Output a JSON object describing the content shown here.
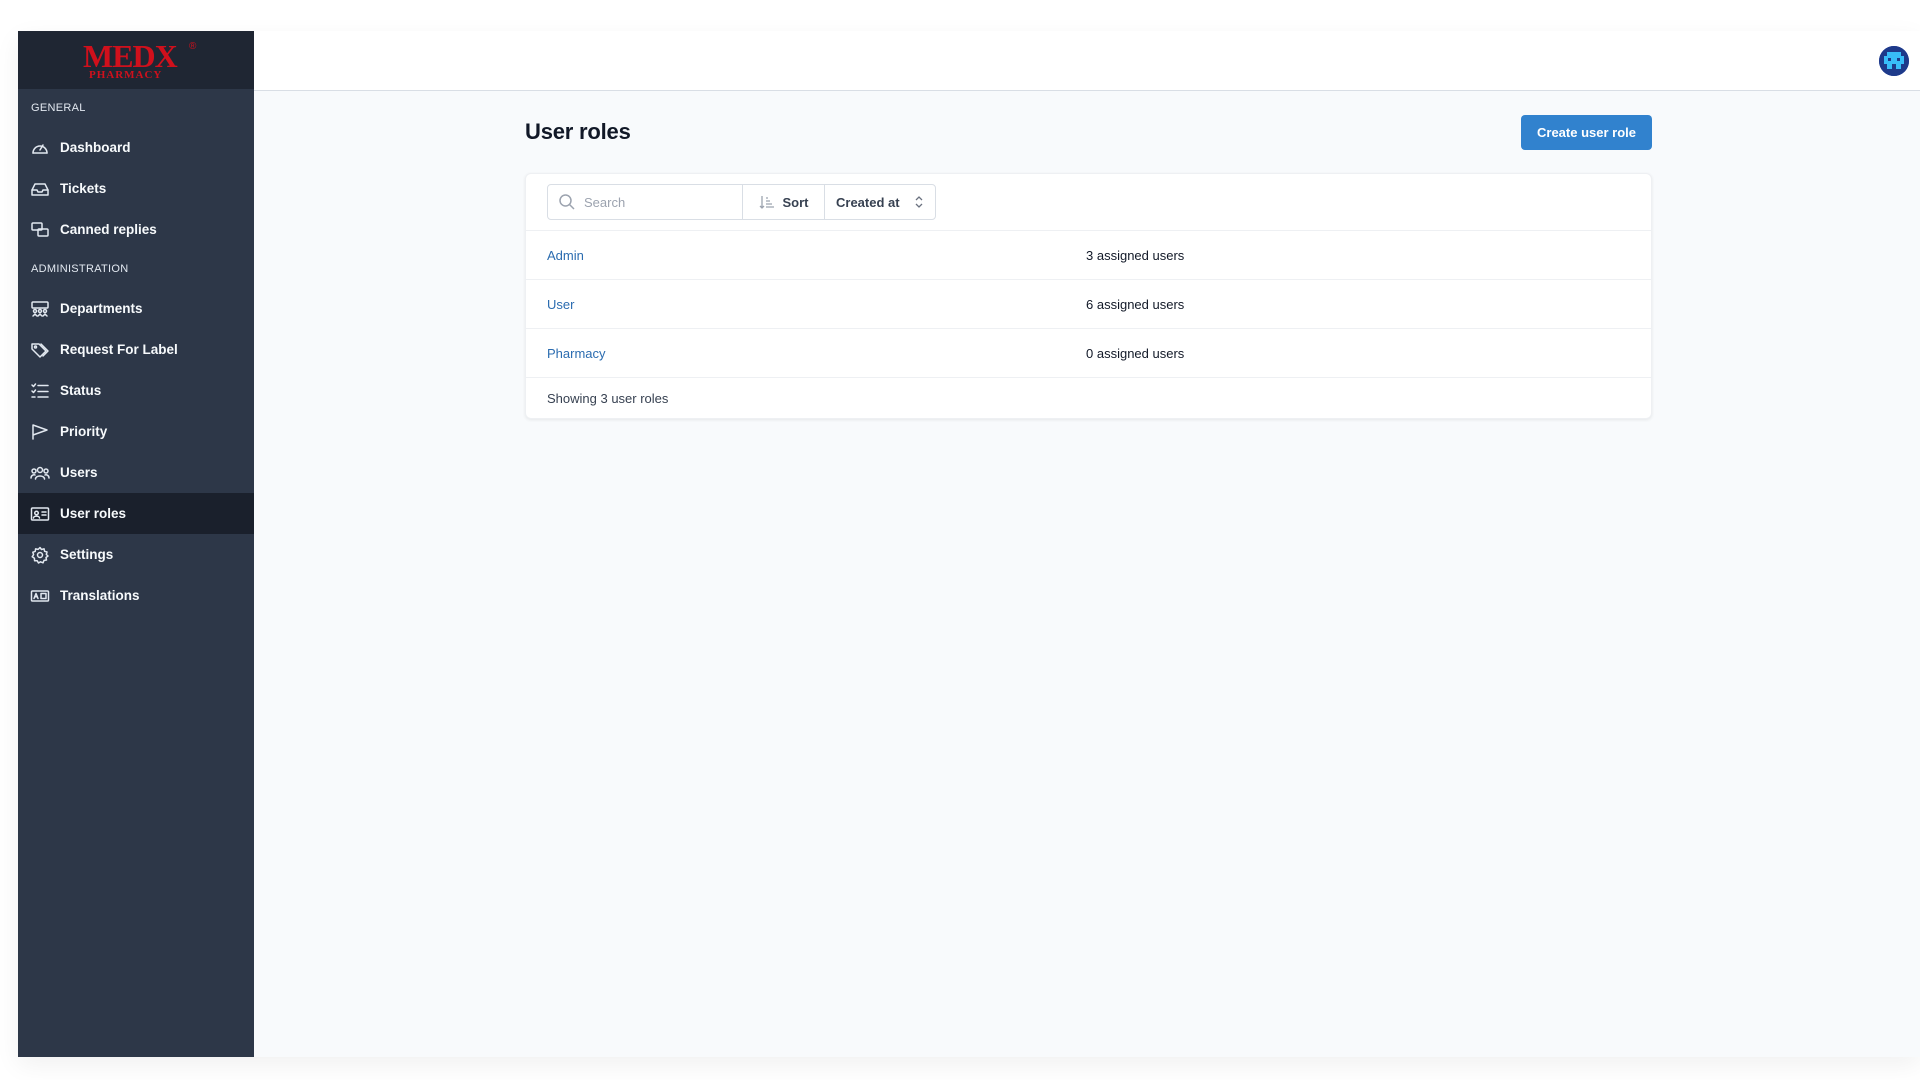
{
  "brand": {
    "logo_text": "MEDX",
    "logo_sub": "PHARMACY",
    "logo_mark": "®",
    "color": "#d0101c"
  },
  "sidebar": {
    "sections": [
      {
        "title": "GENERAL",
        "items": [
          {
            "label": "Dashboard",
            "icon": "dashboard-gauge-icon"
          },
          {
            "label": "Tickets",
            "icon": "inbox-tray-icon"
          },
          {
            "label": "Canned replies",
            "icon": "chat-bubbles-icon"
          }
        ]
      },
      {
        "title": "ADMINISTRATION",
        "items": [
          {
            "label": "Departments",
            "icon": "departments-icon"
          },
          {
            "label": "Request For Label",
            "icon": "tags-icon"
          },
          {
            "label": "Status",
            "icon": "checklist-icon"
          },
          {
            "label": "Priority",
            "icon": "flag-icon"
          },
          {
            "label": "Users",
            "icon": "users-group-icon"
          },
          {
            "label": "User roles",
            "icon": "id-card-icon",
            "active": true
          },
          {
            "label": "Settings",
            "icon": "gear-icon"
          },
          {
            "label": "Translations",
            "icon": "language-icon"
          }
        ]
      }
    ]
  },
  "header": {
    "title": "User roles",
    "create_button": "Create user role"
  },
  "toolbar": {
    "search_placeholder": "Search",
    "sort_label": "Sort",
    "sort_field": "Created at"
  },
  "roles": [
    {
      "name": "Admin",
      "count": "3",
      "count_suffix": " assigned users"
    },
    {
      "name": "User",
      "count": "6",
      "count_suffix": " assigned users"
    },
    {
      "name": "Pharmacy",
      "count": "0",
      "count_suffix": " assigned users"
    }
  ],
  "footer_text": "Showing 3 user roles",
  "colors": {
    "sidebar_bg": "#2d3748",
    "sidebar_active": "#1a202c",
    "accent": "#3182ce",
    "link": "#2b6cb0"
  }
}
